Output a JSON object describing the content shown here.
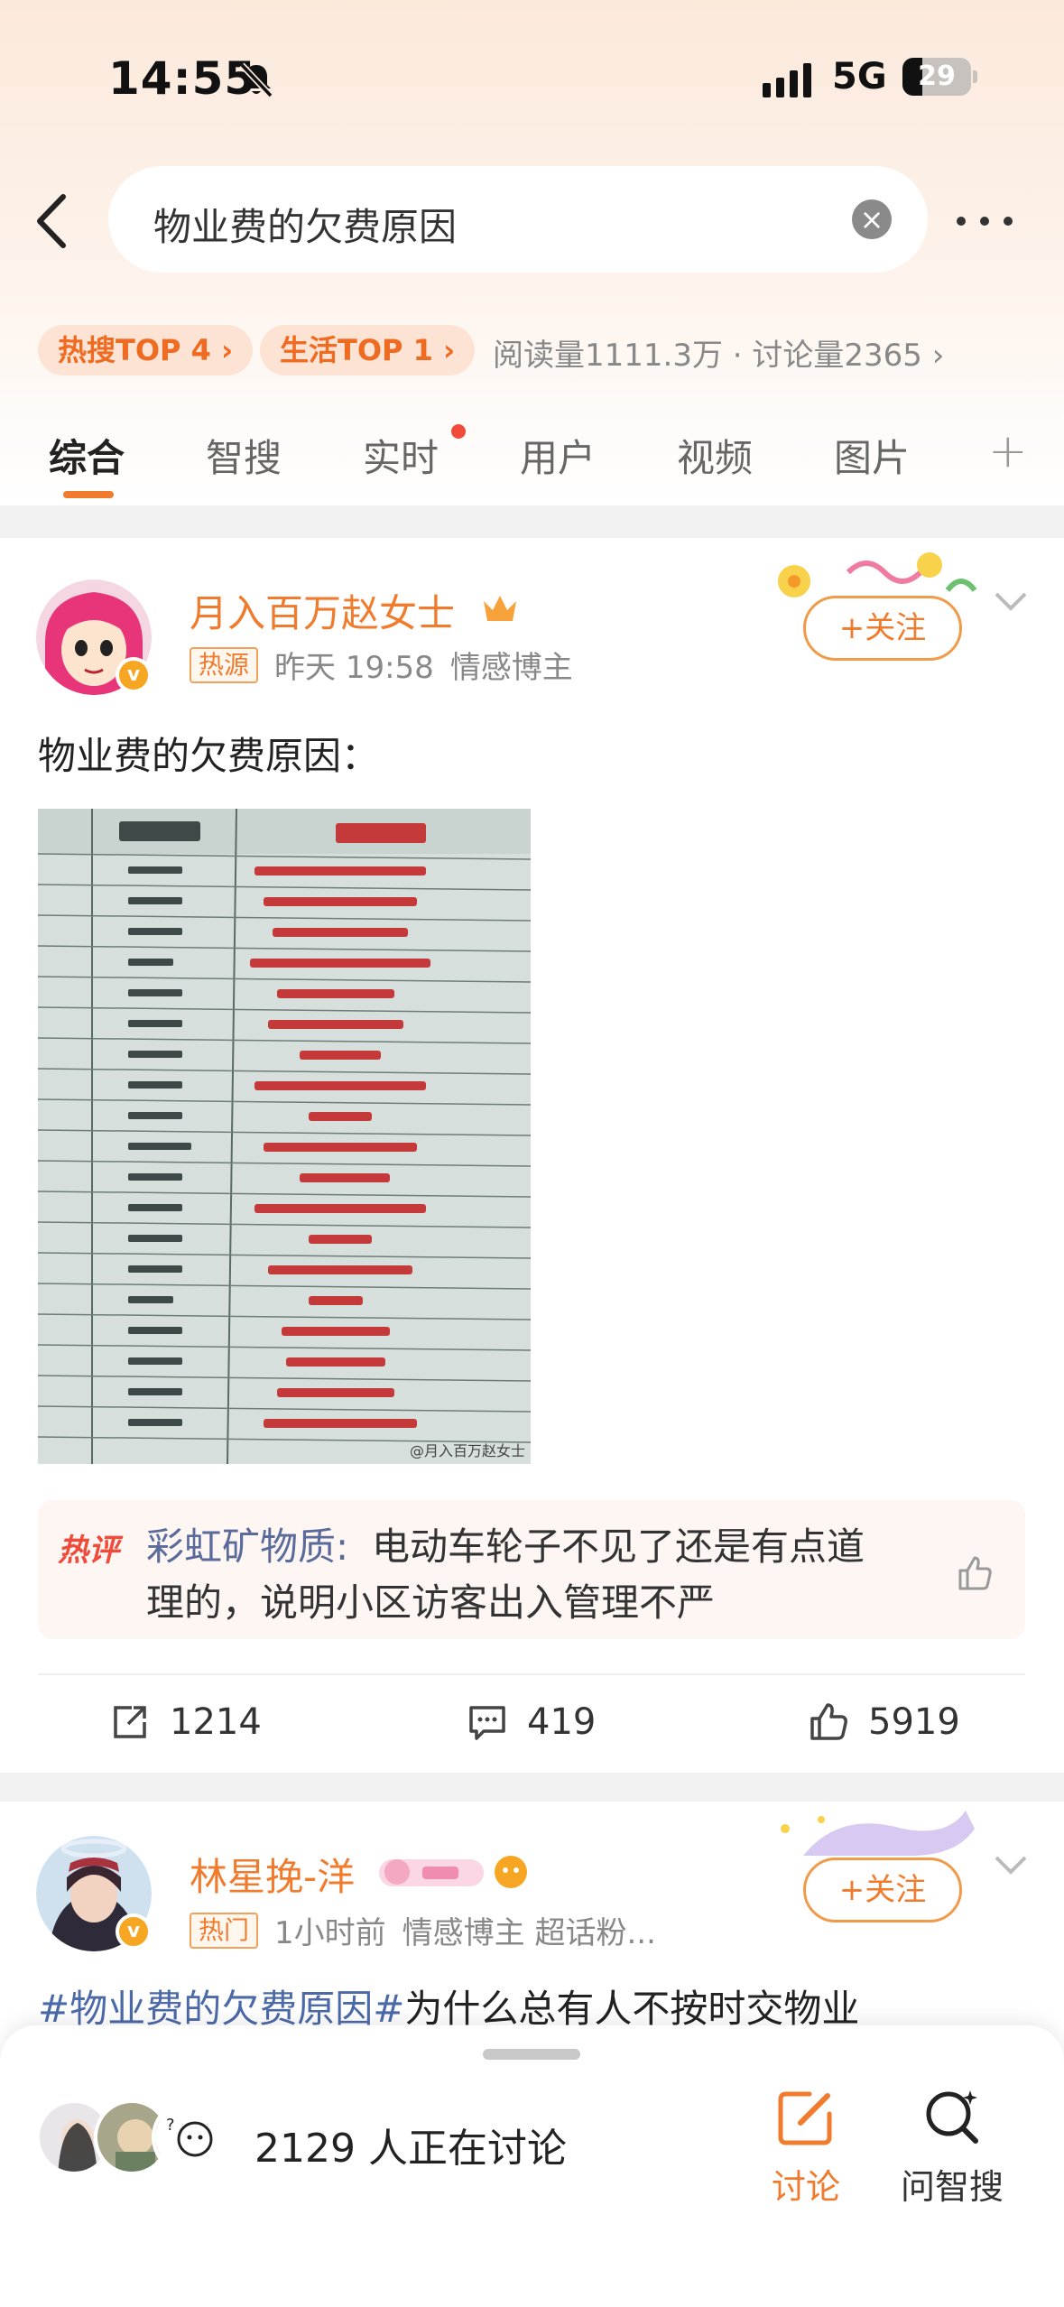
{
  "status_bar": {
    "time": "14:55",
    "network": "5G",
    "battery": "29"
  },
  "search": {
    "query": "物业费的欠费原因"
  },
  "chips": {
    "hot": "热搜TOP 4 ›",
    "life": "生活TOP 1 ›"
  },
  "stats": "阅读量1111.3万 · 讨论量2365 ›",
  "tabs": [
    "综合",
    "智搜",
    "实时",
    "用户",
    "视频",
    "图片"
  ],
  "tab_plus": "+",
  "post1": {
    "username": "月入百万赵女士",
    "tag": "热源",
    "time": "昨天 19:58",
    "role": "情感博主",
    "follow": "+关注",
    "text": "物业费的欠费原因：",
    "image_watermark": "@月入百万赵女士",
    "hot_comment": {
      "label": "热评",
      "user": "彩虹矿物质:",
      "text_line1": "电动车轮子不见了还是有点道",
      "text_line2": "理的，说明小区访客出入管理不严"
    },
    "reposts": "1214",
    "comments": "419",
    "likes": "5919"
  },
  "post2": {
    "username": "林星挽-洋",
    "tag": "热门",
    "time": "1小时前",
    "role": "情感博主 超话粉...",
    "follow": "+关注",
    "hashtag": "#物业费的欠费原因#",
    "text": "为什么总有人不按时交物业"
  },
  "bottom_sheet": {
    "discuss_count": "2129 人正在讨论",
    "discuss_label": "讨论",
    "ask_label": "问智搜"
  },
  "colors": {
    "accent": "#f07b2c",
    "link": "#4c6aa8",
    "hot_red": "#f04a3a"
  }
}
